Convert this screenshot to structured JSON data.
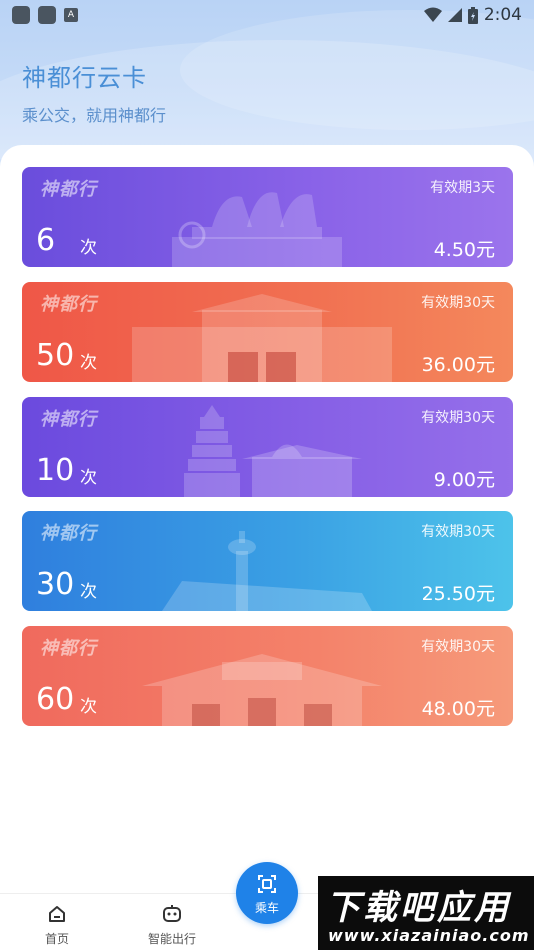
{
  "status_bar": {
    "time": "2:04",
    "notification_badge": "A",
    "icons": [
      "app-notification-icon",
      "app-notification-icon",
      "keyboard-a-icon",
      "wifi-icon",
      "signal-icon",
      "battery-icon"
    ]
  },
  "header": {
    "title": "神都行云卡",
    "subtitle": "乘公交，就用神都行"
  },
  "cards": [
    {
      "brand": "神都行",
      "validity": "有效期3天",
      "times": "6",
      "unit": "次",
      "price": "4.50元",
      "landmark": "chariot-monument"
    },
    {
      "brand": "神都行",
      "validity": "有效期30天",
      "times": "50",
      "unit": "次",
      "price": "36.00元",
      "landmark": "city-gate"
    },
    {
      "brand": "神都行",
      "validity": "有效期30天",
      "times": "10",
      "unit": "次",
      "price": "9.00元",
      "landmark": "pagoda-and-hall"
    },
    {
      "brand": "神都行",
      "validity": "有效期30天",
      "times": "30",
      "unit": "次",
      "price": "25.50元",
      "landmark": "airport-tower"
    },
    {
      "brand": "神都行",
      "validity": "有效期30天",
      "times": "60",
      "unit": "次",
      "price": "48.00元",
      "landmark": "temple-gate"
    }
  ],
  "bottom_nav": {
    "home": "首页",
    "smart_travel": "智能出行",
    "ride": "乘车"
  },
  "watermark": {
    "top": "下载吧应用",
    "bottom": "www.xiazainiao.com"
  },
  "colors": {
    "title": "#4a8fd6",
    "ride_button": "#1f82e8"
  }
}
